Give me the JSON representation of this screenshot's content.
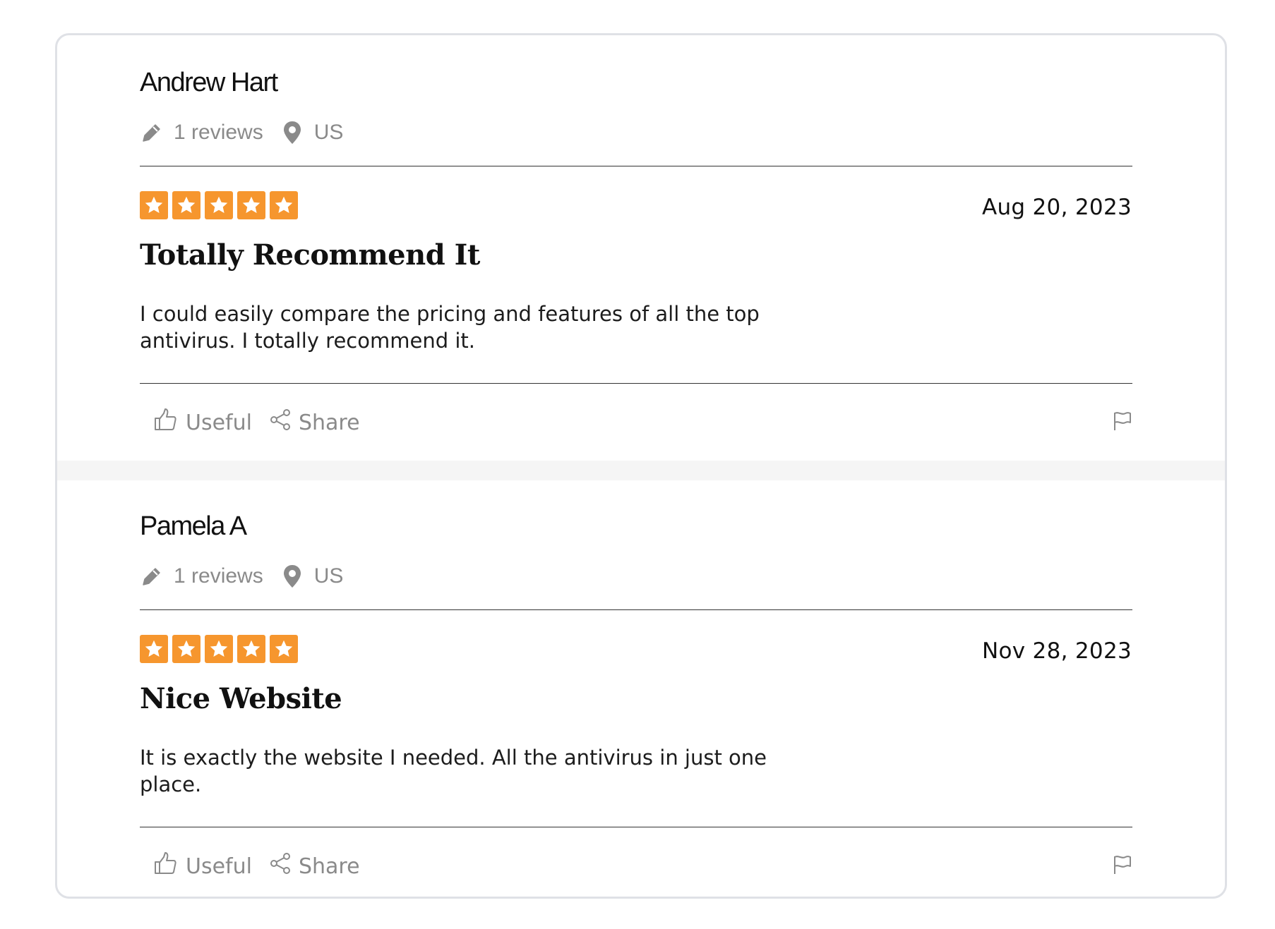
{
  "theme": {
    "star_color": "#f6962e",
    "muted_text": "#8a8a8a",
    "border_color": "#dfe1e6"
  },
  "reviews": [
    {
      "author": "Andrew Hart",
      "reviews_count": "1 reviews",
      "location": "US",
      "rating": 5,
      "date": "Aug 20, 2023",
      "title": "Totally Recommend It",
      "body": "I could easily compare the pricing and features of all the top antivirus. I totally recommend it.",
      "useful_label": "Useful",
      "share_label": "Share"
    },
    {
      "author": "Pamela A",
      "reviews_count": "1 reviews",
      "location": "US",
      "rating": 5,
      "date": "Nov 28, 2023",
      "title": "Nice Website",
      "body": "It is exactly the website I needed. All the antivirus in just one place.",
      "useful_label": "Useful",
      "share_label": "Share"
    }
  ],
  "icons": {
    "reviews_icon": "pencil-icon",
    "location_icon": "map-pin-icon",
    "useful_icon": "thumbs-up-icon",
    "share_icon": "share-icon",
    "report_icon": "flag-icon",
    "star_icon": "star-icon"
  }
}
